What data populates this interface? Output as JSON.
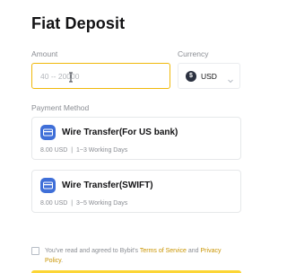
{
  "title": "Fiat Deposit",
  "amount": {
    "label": "Amount",
    "placeholder": "40 -- 20000",
    "value": ""
  },
  "currency": {
    "label": "Currency",
    "selected": "USD",
    "badge": "$"
  },
  "payment": {
    "label": "Payment Method",
    "methods": [
      {
        "name": "Wire Transfer(For US bank)",
        "fee": "8.00 USD",
        "time": "1~3 Working Days"
      },
      {
        "name": "Wire Transfer(SWIFT)",
        "fee": "8.00 USD",
        "time": "3~5 Working Days"
      }
    ]
  },
  "agreement": {
    "prefix": "You've read and agreed to Bybit's ",
    "terms_link": "Terms of Service",
    "and": " and ",
    "privacy_link": "Privacy Policy",
    "suffix": ".",
    "checked": false
  },
  "colors": {
    "accent": "#f0b90b",
    "link": "#c99400",
    "bank_icon": "#3f6fd8",
    "button": "#fcd535"
  }
}
